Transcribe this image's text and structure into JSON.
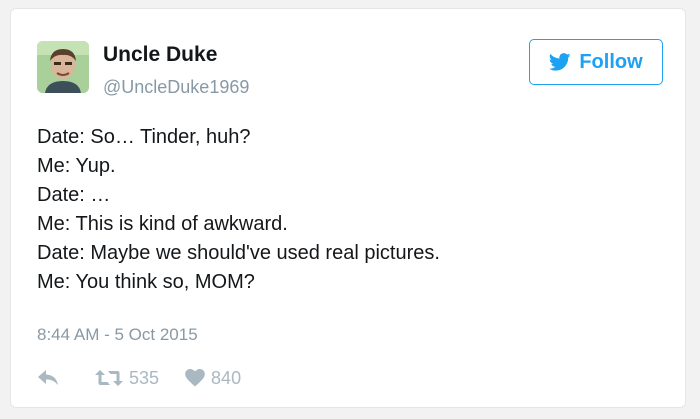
{
  "user": {
    "display_name": "Uncle Duke",
    "handle": "@UncleDuke1969",
    "avatar_icon": "user-avatar-photo"
  },
  "follow_button": {
    "label": "Follow",
    "icon": "bird-icon",
    "color": "#1da1f2"
  },
  "tweet": {
    "lines": [
      "Date: So… Tinder, huh?",
      "Me: Yup.",
      "Date: …",
      "Me: This is kind of awkward.",
      "Date: Maybe we should've used real pictures.",
      "Me: You think so, MOM?"
    ],
    "timestamp": "8:44 AM - 5 Oct 2015"
  },
  "actions": {
    "reply_icon": "reply-icon",
    "retweet_icon": "retweet-icon",
    "retweet_count": "535",
    "like_icon": "heart-icon",
    "like_count": "840"
  },
  "colors": {
    "text_primary": "#14171a",
    "text_secondary": "#8899a6",
    "action_gray": "#aab8c2",
    "accent": "#1da1f2"
  }
}
